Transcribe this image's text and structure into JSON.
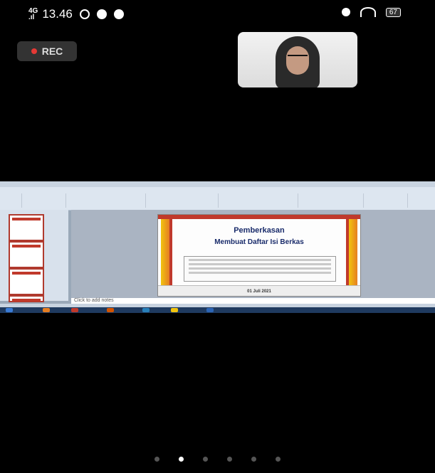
{
  "status_bar": {
    "network": "4G",
    "signal_text": ".ıl",
    "time": "13.46",
    "battery": "67"
  },
  "rec": {
    "label": "REC"
  },
  "screen_share": {
    "slide_title": "Pemberkasan",
    "slide_subtitle": "Membuat Daftar Isi Berkas",
    "slide_date": "01 Juli 2021",
    "notes_placeholder": "Click to add notes"
  },
  "pager": {
    "count": 6,
    "active_index": 1
  }
}
